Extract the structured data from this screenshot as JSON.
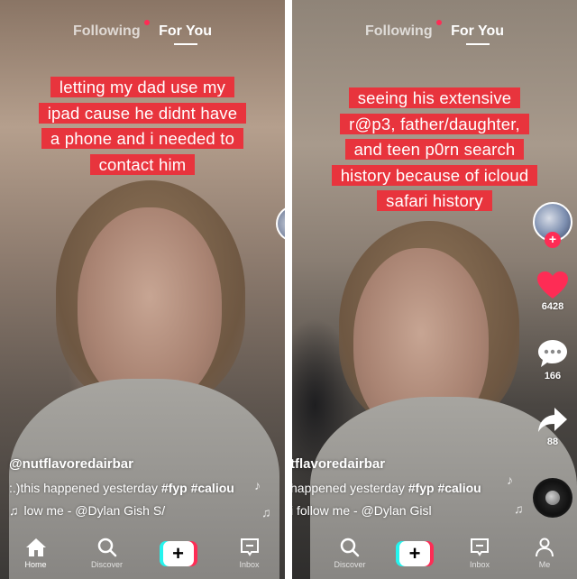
{
  "left_panel": {
    "top_tabs": {
      "following": "Following",
      "for_you": "For You"
    },
    "caption_lines": [
      "letting my dad use my",
      "ipad cause he didnt have",
      "a phone and i needed to",
      "contact him"
    ],
    "username": "@nutflavoredairbar",
    "description_prefix": ":.)this happened yesterday ",
    "hashtags": "#fyp #caliou",
    "sound_icon": "♫",
    "sound_text": "low me - @Dylan Gish   S/",
    "nav": {
      "home": "Home",
      "discover": "Discover",
      "create": "+",
      "inbox": "Inbox"
    }
  },
  "right_panel": {
    "top_tabs": {
      "following": "Following",
      "for_you": "For You"
    },
    "caption_lines": [
      "seeing his extensive",
      "r@p3, father/daughter,",
      "and teen p0rn search",
      "history because of icloud",
      "safari history"
    ],
    "follow_plus": "+",
    "like_count": "6428",
    "comment_count": "166",
    "share_count": "88",
    "username": "tflavoredairbar",
    "description_prefix": " happened yesterday ",
    "hashtags": "#fyp #caliou",
    "sound_text": "i follow me - @Dylan Gisl",
    "nav": {
      "discover": "Discover",
      "create": "+",
      "inbox": "Inbox",
      "me": "Me"
    }
  },
  "colors": {
    "caption_bg": "#e8343d",
    "tiktok_red": "#fe2c55",
    "tiktok_cyan": "#25f4ee"
  },
  "icons": [
    "home-icon",
    "search-icon",
    "inbox-icon",
    "person-icon",
    "heart-icon",
    "comment-icon",
    "share-icon",
    "music-note-icon",
    "music-disc-icon"
  ]
}
